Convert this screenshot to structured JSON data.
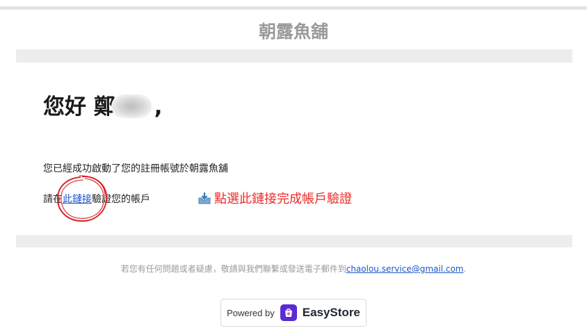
{
  "header": {
    "store_name": "朝露魚舖"
  },
  "greeting": {
    "prefix": "您好 鄭",
    "suffix": ","
  },
  "body": {
    "line1": "您已經成功啟動了您的註冊帳號於朝露魚舖",
    "line2_prefix": "請在",
    "verify_link_label": "此鏈接",
    "line2_suffix": "驗證您的帳戶"
  },
  "annotation": {
    "text": "點選此鏈接完成帳戶驗證",
    "color": "#ea2b2b",
    "icon": "inbox-download-icon"
  },
  "footer": {
    "note": "若您有任何問題或者疑慮，敬請與我們聯繫或發送電子郵件到",
    "email": "chaolou.service@gmail.com",
    "period": "."
  },
  "powered_by": {
    "label": "Powered by",
    "brand": "EasyStore",
    "brand_color": "#5b2ad6"
  },
  "colors": {
    "link": "#1a55c8",
    "band": "#ededed",
    "store_name": "#9a9a9a"
  }
}
